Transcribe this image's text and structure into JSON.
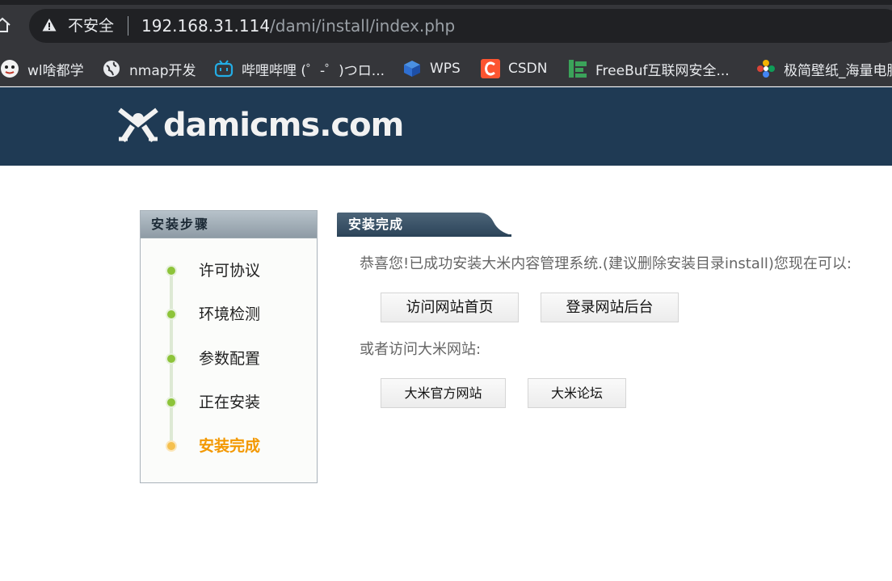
{
  "browser": {
    "security_label": "不安全",
    "url_host": "192.168.31.114",
    "url_path": "/dami/install/index.php"
  },
  "bookmarks": [
    {
      "label": "wl啥都学",
      "icon": "avatar-icon"
    },
    {
      "label": "nmap开发",
      "icon": "globe-icon"
    },
    {
      "label": "哔哩哔哩 (゜-゜)つロ...",
      "icon": "bilibili-icon"
    },
    {
      "label": "WPS",
      "icon": "wps-icon"
    },
    {
      "label": "CSDN",
      "icon": "csdn-icon"
    },
    {
      "label": "FreeBuf互联网安全...",
      "icon": "freebuf-icon"
    },
    {
      "label": "极简壁纸_海量电脑",
      "icon": "wallpaper-icon"
    }
  ],
  "site": {
    "logo_text": "damicms.com"
  },
  "steps": {
    "title": "安装步骤",
    "items": [
      {
        "label": "许可协议",
        "current": false
      },
      {
        "label": "环境检测",
        "current": false
      },
      {
        "label": "参数配置",
        "current": false
      },
      {
        "label": "正在安装",
        "current": false
      },
      {
        "label": "安装完成",
        "current": true
      }
    ]
  },
  "main": {
    "title": "安装完成",
    "message": "恭喜您!已成功安装大米内容管理系统.(建议删除安装目录install)您现在可以:",
    "visit_home_label": "访问网站首页",
    "login_admin_label": "登录网站后台",
    "or_text": "或者访问大米网站:",
    "official_site_label": "大米官方网站",
    "forum_label": "大米论坛"
  },
  "colors": {
    "header_bg": "#1f3a54",
    "step_done": "#8dc43a",
    "step_current": "#f39800"
  }
}
